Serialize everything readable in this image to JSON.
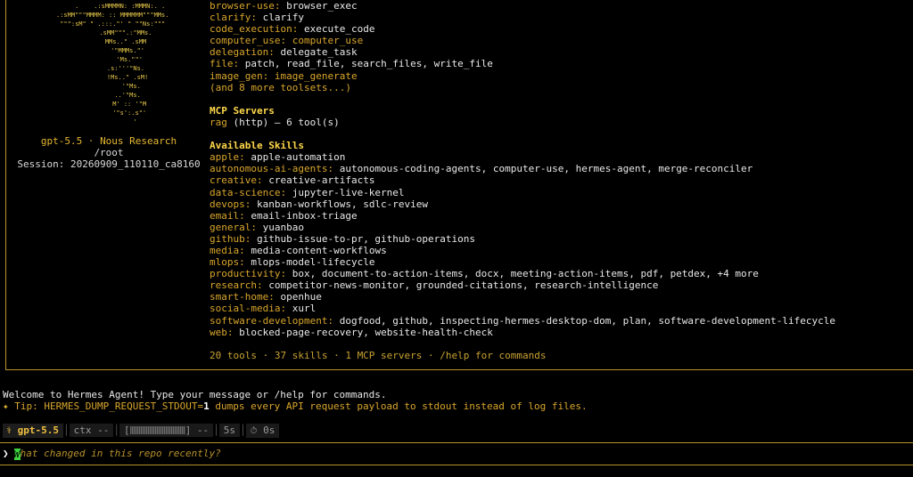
{
  "banner": {
    "ascii_art": "      .    .:sMMMMN: :MMMN:. .\n  .:sMM\"\"\"MMMM: :: MMMMMM\"\"\"MMs.\n  \"\"\":sM\" \" .:::.\"' \" \"\"Ns:\"\"\"\n         .sMM\"\"\".:\"MMs.\n         MMs..\" .sMM\n          '\"MMMs.\"'\n           'Ms.\"\"'\n         .s:'''\"Ns.\n          !Ms..\" .sM!\n            '\"Ms.\n          ..'\"Ms.\n           M' :: '\"M\n           '\"s':.s\"'\n              '",
    "model": "gpt-5.5",
    "separator": " · ",
    "provider": "Nous Research",
    "cwd": "/root",
    "session_label": "Session:",
    "session_id": "20260909_110110_ca8160"
  },
  "toolsets": [
    {
      "key": "browser-use:",
      "value": "browser_exec",
      "value_muted": false
    },
    {
      "key": "clarify:",
      "value": "clarify",
      "value_muted": false
    },
    {
      "key": "code_execution:",
      "value": "execute_code",
      "value_muted": false
    },
    {
      "key": "computer_use:",
      "value": "computer_use",
      "value_muted": true
    },
    {
      "key": "delegation:",
      "value": "delegate_task",
      "value_muted": false
    },
    {
      "key": "file:",
      "value": "patch, read_file, search_files, write_file",
      "value_muted": false
    },
    {
      "key": "image_gen:",
      "value": "image_generate",
      "value_muted": true
    }
  ],
  "more_toolsets": "(and 8 more toolsets...)",
  "mcp": {
    "title": "MCP Servers",
    "servers": [
      {
        "name": "rag",
        "detail": "(http) — 6 tool(s)"
      }
    ]
  },
  "skills": {
    "title": "Available Skills",
    "items": [
      {
        "key": "apple:",
        "value": "apple-automation"
      },
      {
        "key": "autonomous-ai-agents:",
        "value": "autonomous-coding-agents, computer-use, hermes-agent, merge-reconciler"
      },
      {
        "key": "creative:",
        "value": "creative-artifacts"
      },
      {
        "key": "data-science:",
        "value": "jupyter-live-kernel"
      },
      {
        "key": "devops:",
        "value": "kanban-workflows, sdlc-review"
      },
      {
        "key": "email:",
        "value": "email-inbox-triage"
      },
      {
        "key": "general:",
        "value": "yuanbao"
      },
      {
        "key": "github:",
        "value": "github-issue-to-pr, github-operations"
      },
      {
        "key": "media:",
        "value": "media-content-workflows"
      },
      {
        "key": "mlops:",
        "value": "mlops-model-lifecycle"
      },
      {
        "key": "productivity:",
        "value": "box, document-to-action-items, docx, meeting-action-items, pdf, petdex, +4 more"
      },
      {
        "key": "research:",
        "value": "competitor-news-monitor, grounded-citations, research-intelligence"
      },
      {
        "key": "smart-home:",
        "value": "openhue"
      },
      {
        "key": "social-media:",
        "value": "xurl"
      },
      {
        "key": "software-development:",
        "value": "dogfood, github, inspecting-hermes-desktop-dom, plan, software-development-lifecycle"
      },
      {
        "key": "web:",
        "value": "blocked-page-recovery, website-health-check"
      }
    ]
  },
  "summary": "20 tools · 37 skills · 1 MCP servers · /help for commands",
  "welcome": "Welcome to Hermes Agent! Type your message or /help for commands.",
  "tip": {
    "star": "✦",
    "prefix": " Tip: HERMES_DUMP_REQUEST_STDOUT=",
    "num": "1",
    "suffix": " dumps every API request payload to stdout instead of log files."
  },
  "status_bar": {
    "model_icon": "⚕",
    "model": "gpt-5.5",
    "ctx": "ctx --",
    "bar_open": "[",
    "bar_close": "] --",
    "duration": "5s",
    "timer_icon": "⏱",
    "timer": "0s"
  },
  "input": {
    "caret": "❯",
    "first_char": "W",
    "placeholder": "hat changed in this repo recently?"
  },
  "colors": {
    "accent": "#d9a62c",
    "border": "#b8922a",
    "cursor": "#3fd43f",
    "background": "#000000"
  }
}
